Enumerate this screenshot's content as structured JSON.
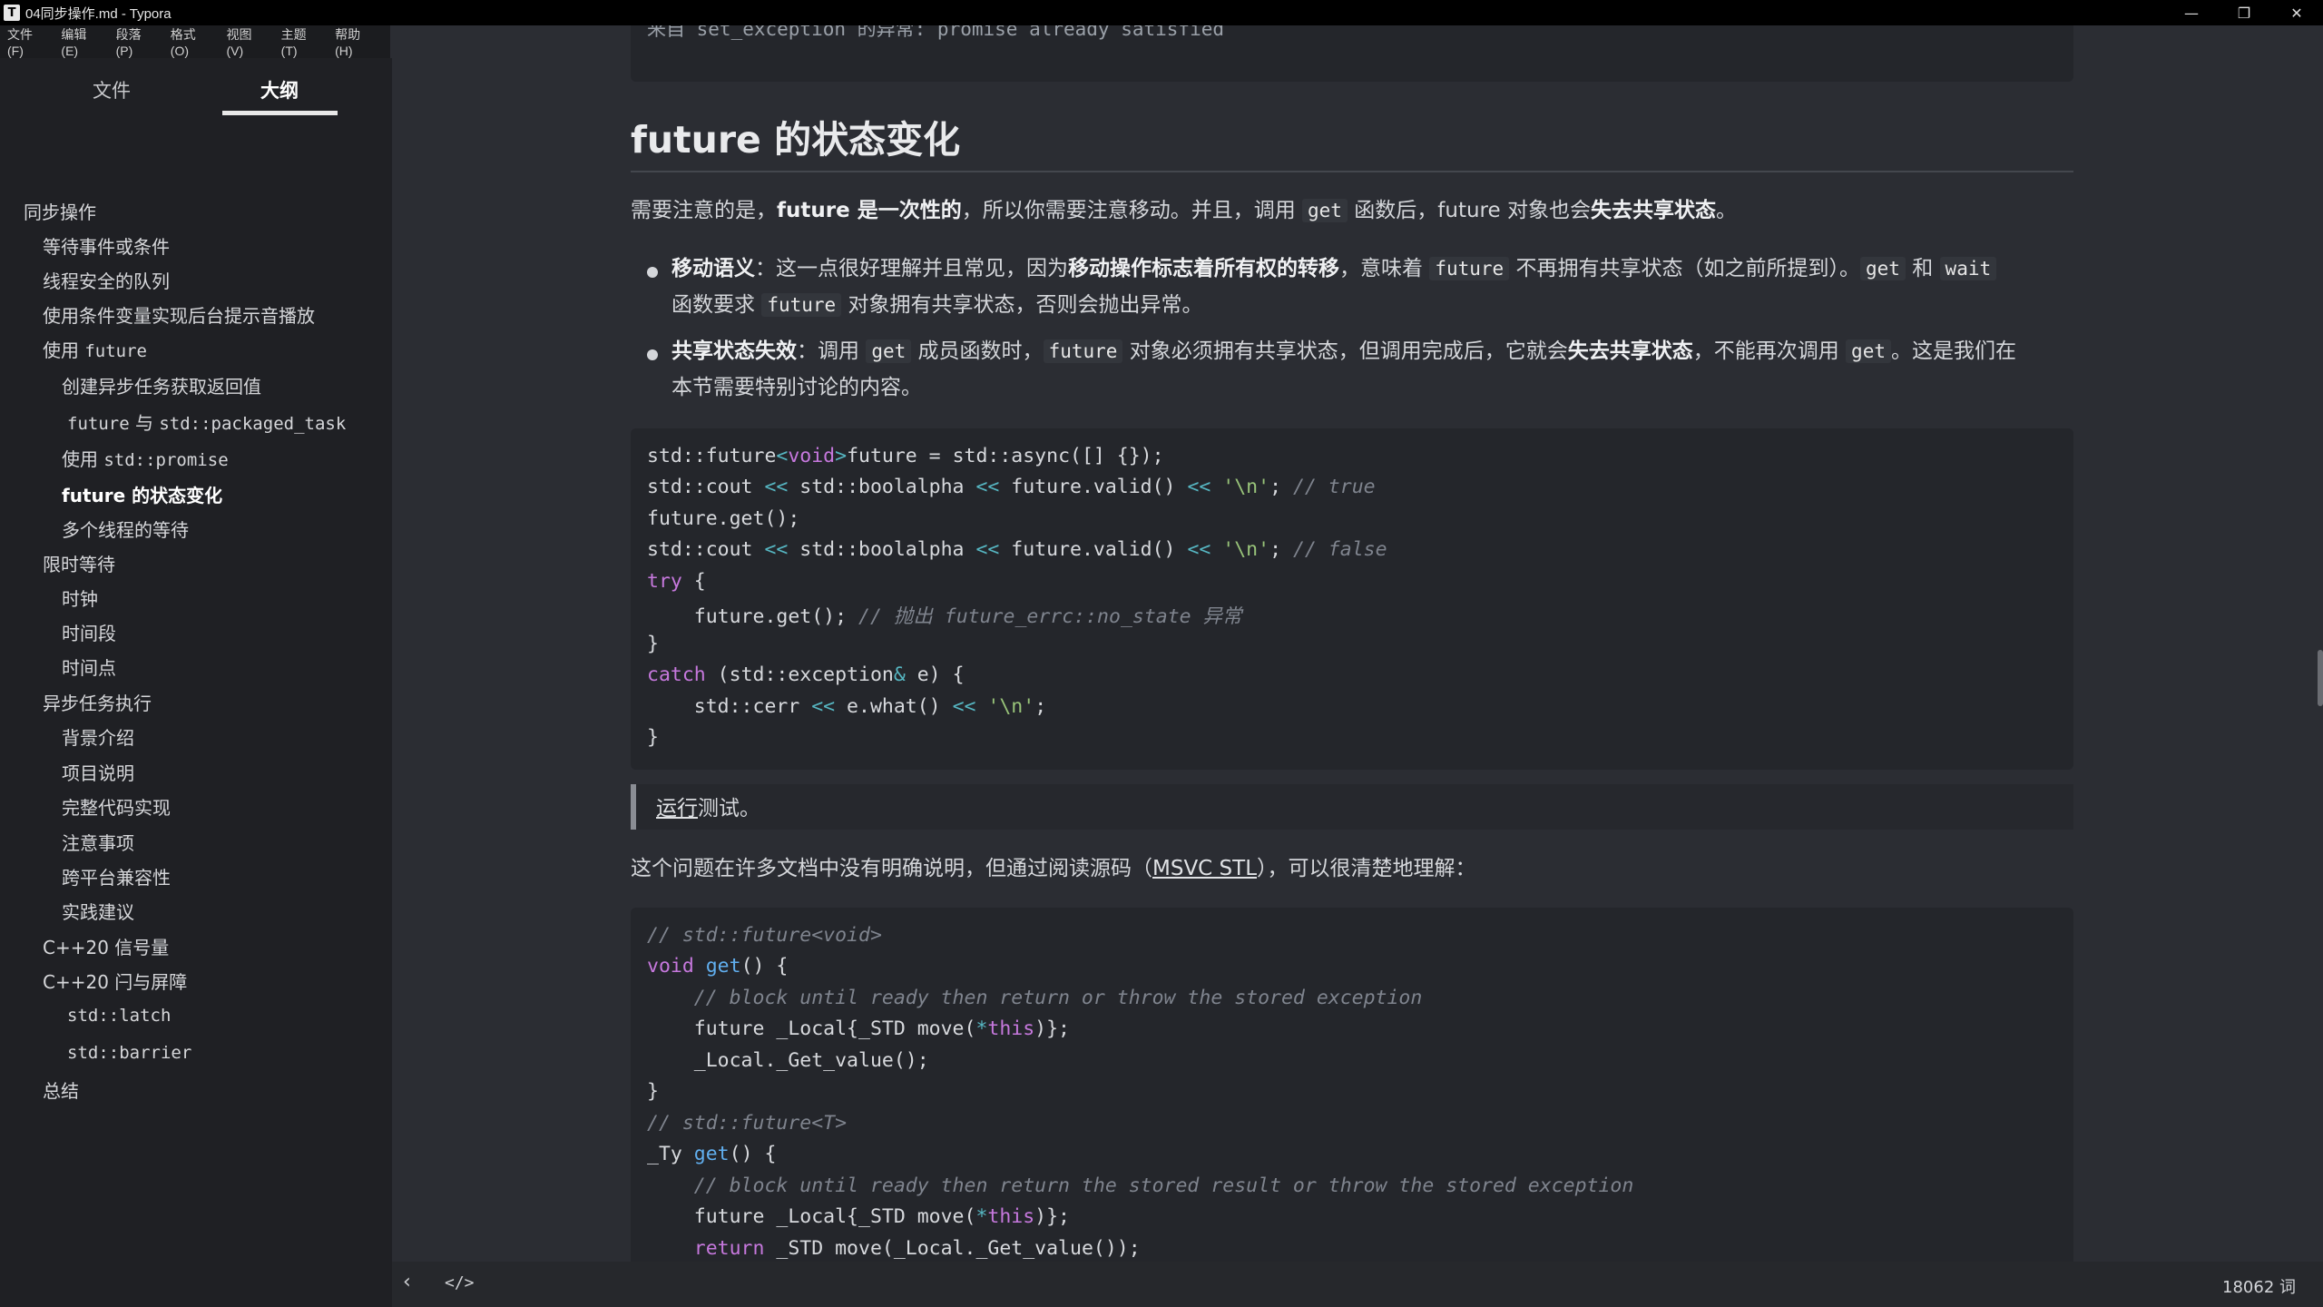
{
  "window": {
    "title": "04同步操作.md - Typora",
    "app_icon": "T",
    "controls": {
      "minimize": "—",
      "restore": "❐",
      "close": "✕"
    }
  },
  "menu": [
    "文件(F)",
    "编辑(E)",
    "段落(P)",
    "格式(O)",
    "视图(V)",
    "主题(T)",
    "帮助(H)"
  ],
  "sidebar": {
    "tabs": [
      "文件",
      "大纲"
    ],
    "active_tab": "大纲",
    "outline": [
      {
        "label": "同步操作",
        "level": 1
      },
      {
        "label": "等待事件或条件",
        "level": 2
      },
      {
        "label": "线程安全的队列",
        "level": 2
      },
      {
        "label": "使用条件变量实现后台提示音播放",
        "level": 2
      },
      {
        "label_prefix": "使用 ",
        "code": "future",
        "level": 2
      },
      {
        "label": "创建异步任务获取返回值",
        "level": 3
      },
      {
        "code": "future",
        "label_mid": " 与 ",
        "code2": "std::packaged_task",
        "level": 3
      },
      {
        "label_prefix": "使用 ",
        "code": "std::promise",
        "level": 3
      },
      {
        "label": "future 的状态变化",
        "level": 3,
        "active": true
      },
      {
        "label": "多个线程的等待",
        "level": 3
      },
      {
        "label": "限时等待",
        "level": 2
      },
      {
        "label": "时钟",
        "level": 3
      },
      {
        "label": "时间段",
        "level": 3
      },
      {
        "label": "时间点",
        "level": 3
      },
      {
        "label": "异步任务执行",
        "level": 2
      },
      {
        "label": "背景介绍",
        "level": 3
      },
      {
        "label": "项目说明",
        "level": 3
      },
      {
        "label": "完整代码实现",
        "level": 3
      },
      {
        "label": "注意事项",
        "level": 3
      },
      {
        "label": "跨平台兼容性",
        "level": 3
      },
      {
        "label": "实践建议",
        "level": 3
      },
      {
        "label": "C++20 信号量",
        "level": 2
      },
      {
        "label": "C++20 闩与屏障",
        "level": 2
      },
      {
        "code": "std::latch",
        "level": 3
      },
      {
        "code": "std::barrier",
        "level": 3
      },
      {
        "label": "总结",
        "level": 2
      }
    ]
  },
  "document": {
    "prev_code_tail": "来自 set_exception 的异常: promise already satisfied",
    "heading": "future 的状态变化",
    "intro": {
      "t1": "需要注意的是，",
      "b1": "future 是一次性的",
      "t2": "，所以你需要注意移动。并且，调用 ",
      "c1": "get",
      "t3": " 函数后，future 对象也会",
      "b2": "失去共享状态",
      "t4": "。"
    },
    "bullets": [
      {
        "line1": {
          "b1": "移动语义",
          "t1": "：这一点很好理解并且常见，因为",
          "b2": "移动操作标志着所有权的转移",
          "t2": "，意味着 ",
          "c1": "future",
          "t3": " 不再拥有共享状态（如之前所提到）。",
          "c2": "get",
          "t4": " 和 ",
          "c3": "wait"
        },
        "line2": {
          "t1": "函数要求 ",
          "c1": "future",
          "t2": " 对象拥有共享状态，否则会抛出异常。"
        }
      },
      {
        "line1": {
          "b1": "共享状态失效",
          "t1": "：调用 ",
          "c1": "get",
          "t2": " 成员函数时，",
          "c2": "future",
          "t3": " 对象必须拥有共享状态，但调用完成后，它就会",
          "b2": "失去共享状态",
          "t4": "，不能再次调用 ",
          "c3": "get",
          "t5": "。这是我们在"
        },
        "line2": {
          "t1": "本节需要特别讨论的内容。"
        }
      }
    ],
    "code1": [
      "std::future<void>future = std::async([] {});",
      "std::cout << std::boolalpha << future.valid() << '\\n'; // true",
      "future.get();",
      "std::cout << std::boolalpha << future.valid() << '\\n'; // false",
      "try {",
      "    future.get(); // 抛出 future_errc::no_state 异常",
      "}",
      "catch (std::exception& e) {",
      "    std::cerr << e.what() << '\\n';",
      "}"
    ],
    "quote": {
      "link": "运行",
      "text": "测试。"
    },
    "para2": {
      "t1": "这个问题在许多文档中没有明确说明，但通过阅读源码（",
      "link": "MSVC STL",
      "t2": "），可以很清楚地理解："
    },
    "code2": [
      "// std::future<void>",
      "void get() {",
      "    // block until ready then return or throw the stored exception",
      "    future _Local{_STD move(*this)};",
      "    _Local._Get_value();",
      "}",
      "// std::future<T>",
      "_Ty get() {",
      "    // block until ready then return the stored result or throw the stored exception",
      "    future _Local{_STD move(*this)};",
      "    return _STD move(_Local._Get_value());"
    ]
  },
  "statusbar": {
    "back_icon": "‹",
    "source_icon": "</>",
    "word_count": "18062 词"
  }
}
